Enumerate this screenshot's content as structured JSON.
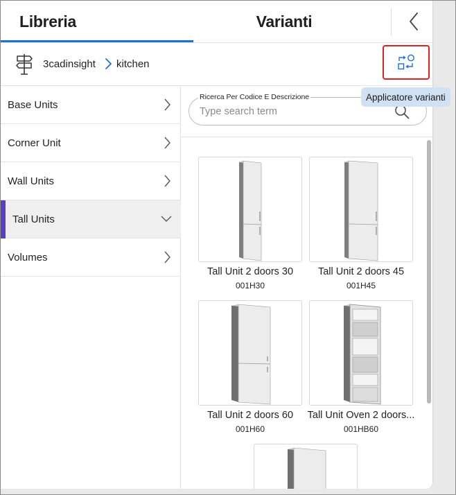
{
  "tabs": {
    "libreria": "Libreria",
    "varianti": "Varianti"
  },
  "breadcrumb": {
    "root": "3cadinsight",
    "current": "kitchen"
  },
  "tooltip": "Applicatore varianti",
  "categories": [
    {
      "label": "Base Units"
    },
    {
      "label": "Corner Unit"
    },
    {
      "label": "Wall Units"
    },
    {
      "label": "Tall Units",
      "active": true
    },
    {
      "label": "Volumes"
    }
  ],
  "search": {
    "legend": "Ricerca Per Codice E Descrizione",
    "placeholder": "Type search term"
  },
  "items": [
    {
      "name": "Tall Unit 2 doors 30",
      "code": "001H30"
    },
    {
      "name": "Tall Unit 2 doors 45",
      "code": "001H45"
    },
    {
      "name": "Tall Unit 2 doors 60",
      "code": "001H60"
    },
    {
      "name": "Tall Unit Oven 2 doors...",
      "code": "001HB60"
    }
  ],
  "colors": {
    "accent": "#1f6fd1",
    "active_marker": "#5a3fc4",
    "highlight_border": "#e02020",
    "tooltip_bg": "#cfe1f3"
  }
}
